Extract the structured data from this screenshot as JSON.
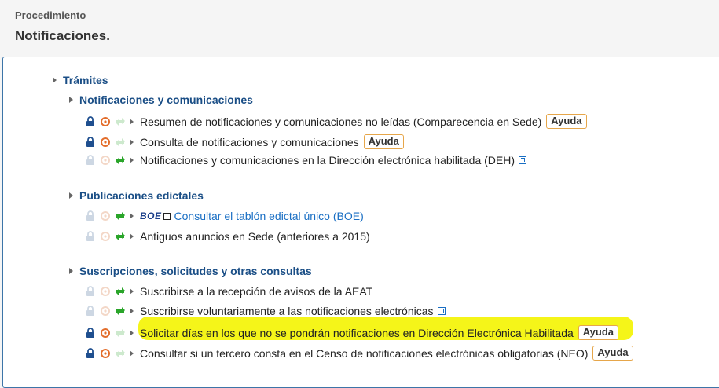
{
  "header": {
    "pretitle": "Procedimiento",
    "title": "Notificaciones."
  },
  "tree": {
    "root_label": "Trámites",
    "sections": [
      {
        "title": "Notificaciones y comunicaciones",
        "items": [
          {
            "text": "Resumen de notificaciones y comunicaciones no leídas (Comparecencia en Sede)",
            "help": "Ayuda"
          },
          {
            "text": "Consulta de notificaciones y comunicaciones",
            "help": "Ayuda"
          },
          {
            "text": "Notificaciones y comunicaciones en la Dirección electrónica habilitada (DEH)"
          }
        ]
      },
      {
        "title": "Publicaciones edictales",
        "items": [
          {
            "text": "Consultar el tablón edictal único (BOE)",
            "logo": "BOE"
          },
          {
            "text": "Antiguos anuncios en Sede (anteriores a 2015)"
          }
        ]
      },
      {
        "title": "Suscripciones, solicitudes y otras consultas",
        "items": [
          {
            "text": "Suscribirse a la recepción de avisos de la AEAT"
          },
          {
            "text": "Suscribirse voluntariamente a las notificaciones electrónicas"
          },
          {
            "text": "Solicitar días en los que no se pondrán notificaciones en Dirección Electrónica Habilitada",
            "help": "Ayuda"
          },
          {
            "text": "Consultar si un tercero consta en el Censo de notificaciones electrónicas obligatorias (NEO)",
            "help": "Ayuda"
          }
        ]
      }
    ]
  },
  "icons": {
    "lock_active": "#1f4f8f",
    "lock_inactive": "#cdd7e3",
    "cert_active": "#e36d2b",
    "cert_inactive": "#f3d7c7",
    "key_active": "#2aa52a",
    "key_inactive": "#cde9cd"
  },
  "highlight_color": "#f4f400"
}
